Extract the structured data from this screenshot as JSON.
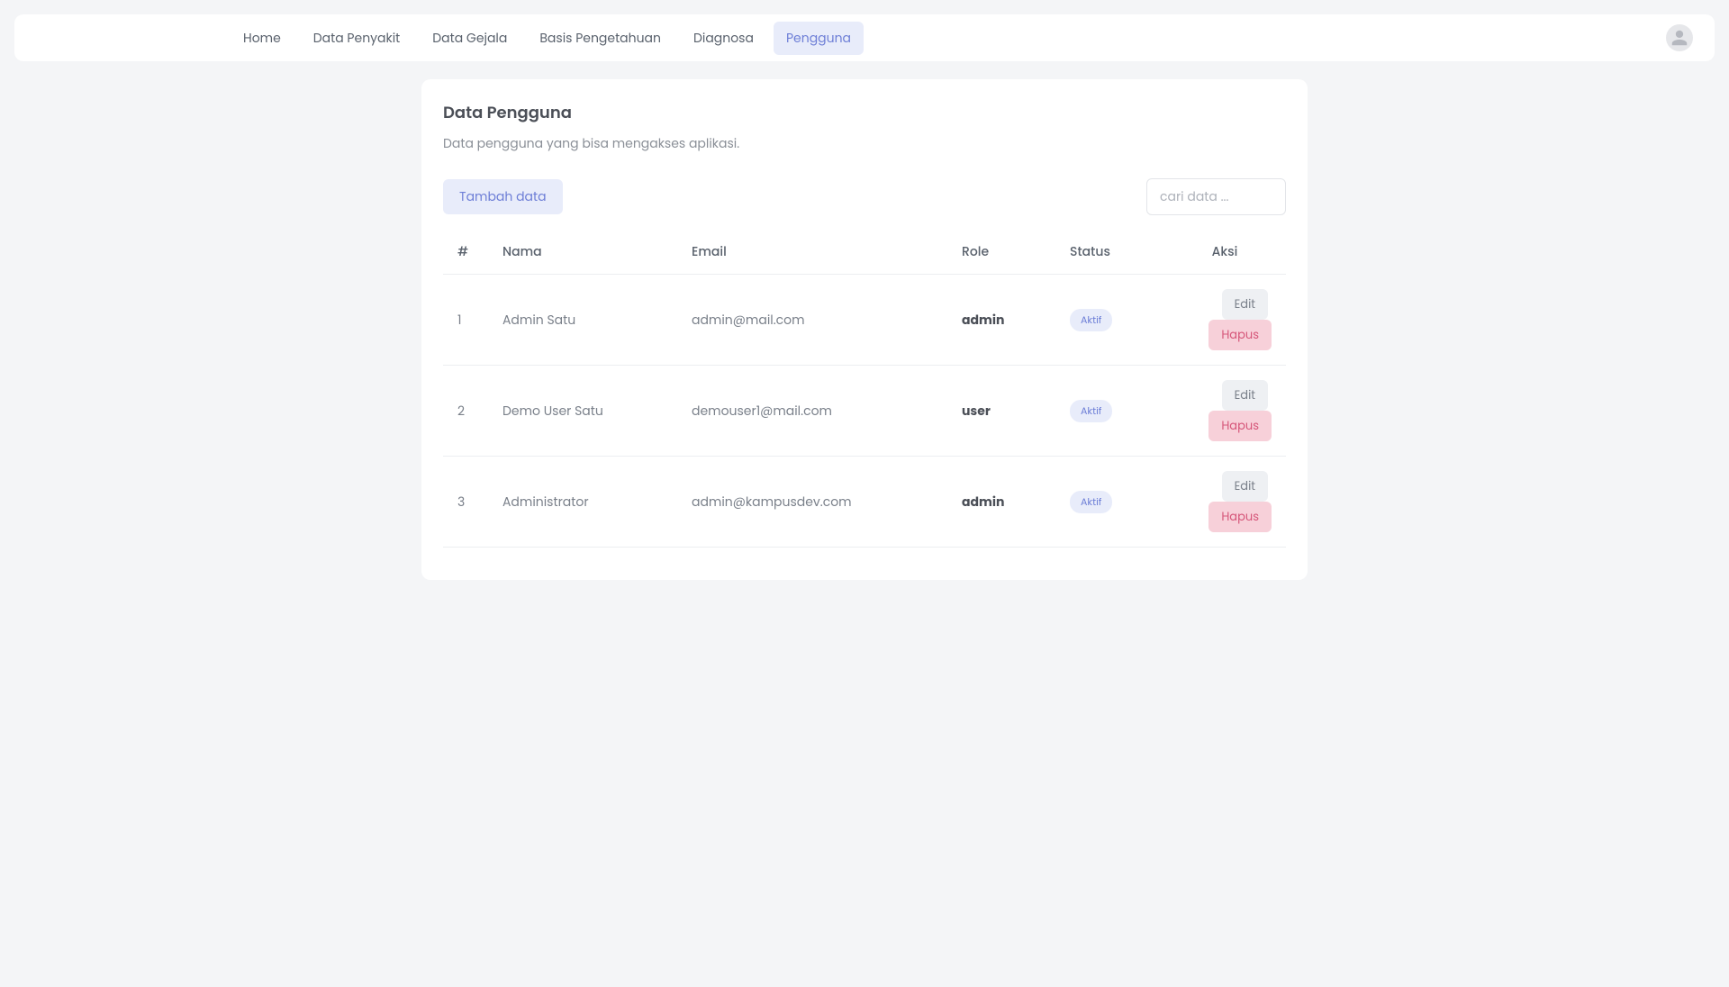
{
  "nav": {
    "items": [
      {
        "label": "Home",
        "active": false
      },
      {
        "label": "Data Penyakit",
        "active": false
      },
      {
        "label": "Data Gejala",
        "active": false
      },
      {
        "label": "Basis Pengetahuan",
        "active": false
      },
      {
        "label": "Diagnosa",
        "active": false
      },
      {
        "label": "Pengguna",
        "active": true
      }
    ]
  },
  "page": {
    "title": "Data Pengguna",
    "subtitle": "Data pengguna yang bisa mengakses aplikasi."
  },
  "toolbar": {
    "add_label": "Tambah data",
    "search_placeholder": "cari data ..."
  },
  "table": {
    "headers": {
      "num": "#",
      "nama": "Nama",
      "email": "Email",
      "role": "Role",
      "status": "Status",
      "aksi": "Aksi"
    },
    "action_labels": {
      "edit": "Edit",
      "hapus": "Hapus"
    },
    "rows": [
      {
        "num": "1",
        "nama": "Admin Satu",
        "email": "admin@mail.com",
        "role": "admin",
        "status": "Aktif"
      },
      {
        "num": "2",
        "nama": "Demo User Satu",
        "email": "demouser1@mail.com",
        "role": "user",
        "status": "Aktif"
      },
      {
        "num": "3",
        "nama": "Administrator",
        "email": "admin@kampusdev.com",
        "role": "admin",
        "status": "Aktif"
      }
    ]
  }
}
